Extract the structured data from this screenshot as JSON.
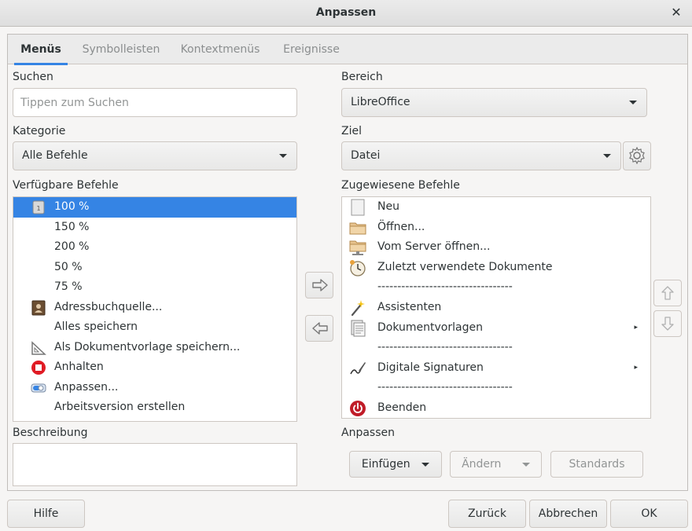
{
  "window": {
    "title": "Anpassen",
    "close_glyph": "✕"
  },
  "tabs": [
    {
      "label": "Menüs",
      "active": true
    },
    {
      "label": "Symbolleisten",
      "active": false
    },
    {
      "label": "Kontextmenüs",
      "active": false
    },
    {
      "label": "Ereignisse",
      "active": false
    }
  ],
  "left": {
    "search_label": "Suchen",
    "search_placeholder": "Tippen zum Suchen",
    "search_value": "",
    "category_label": "Kategorie",
    "category_value": "Alle Befehle",
    "available_label": "Verfügbare Befehle",
    "available_items": [
      {
        "label": "100 %",
        "icon": "zoom-100-icon",
        "selected": true
      },
      {
        "label": "150 %",
        "icon": "",
        "selected": false
      },
      {
        "label": "200 %",
        "icon": "",
        "selected": false
      },
      {
        "label": "50 %",
        "icon": "",
        "selected": false
      },
      {
        "label": "75 %",
        "icon": "",
        "selected": false
      },
      {
        "label": "Adressbuchquelle...",
        "icon": "address-book-icon",
        "selected": false
      },
      {
        "label": "Alles speichern",
        "icon": "",
        "selected": false
      },
      {
        "label": "Als Dokumentvorlage speichern...",
        "icon": "template-triangle-icon",
        "selected": false
      },
      {
        "label": "Anhalten",
        "icon": "stop-icon",
        "selected": false
      },
      {
        "label": "Anpassen...",
        "icon": "customize-toggle-icon",
        "selected": false
      },
      {
        "label": "Arbeitsversion erstellen",
        "icon": "",
        "selected": false
      }
    ],
    "description_label": "Beschreibung"
  },
  "right": {
    "scope_label": "Bereich",
    "scope_value": "LibreOffice",
    "target_label": "Ziel",
    "target_value": "Datei",
    "assigned_label": "Zugewiesene Befehle",
    "assigned_items": [
      {
        "label": "Neu",
        "icon": "new-document-icon",
        "submenu": false
      },
      {
        "label": "Öffnen...",
        "icon": "folder-open-icon",
        "submenu": false
      },
      {
        "label": "Vom Server öffnen...",
        "icon": "folder-remote-icon",
        "submenu": false
      },
      {
        "label": "Zuletzt verwendete Dokumente",
        "icon": "recent-clock-icon",
        "submenu": false
      },
      {
        "label": "----------------------------------",
        "icon": "",
        "submenu": false,
        "separator": true
      },
      {
        "label": "Assistenten",
        "icon": "wizard-wand-icon",
        "submenu": false
      },
      {
        "label": "Dokumentvorlagen",
        "icon": "templates-icon",
        "submenu": true
      },
      {
        "label": "----------------------------------",
        "icon": "",
        "submenu": false,
        "separator": true
      },
      {
        "label": "Digitale Signaturen",
        "icon": "signature-pen-icon",
        "submenu": true
      },
      {
        "label": "----------------------------------",
        "icon": "",
        "submenu": false,
        "separator": true
      },
      {
        "label": "Beenden",
        "icon": "power-exit-icon",
        "submenu": false
      }
    ],
    "submenu_glyph": "▸",
    "customize_label": "Anpassen",
    "insert_label": "Einfügen",
    "modify_label": "Ändern",
    "defaults_label": "Standards"
  },
  "footer": {
    "help_label": "Hilfe",
    "reset_label": "Zurück",
    "cancel_label": "Abbrechen",
    "ok_label": "OK"
  },
  "colors": {
    "selection": "#3584e4",
    "stop_red": "#e01b24",
    "exit_red": "#c01c28"
  }
}
